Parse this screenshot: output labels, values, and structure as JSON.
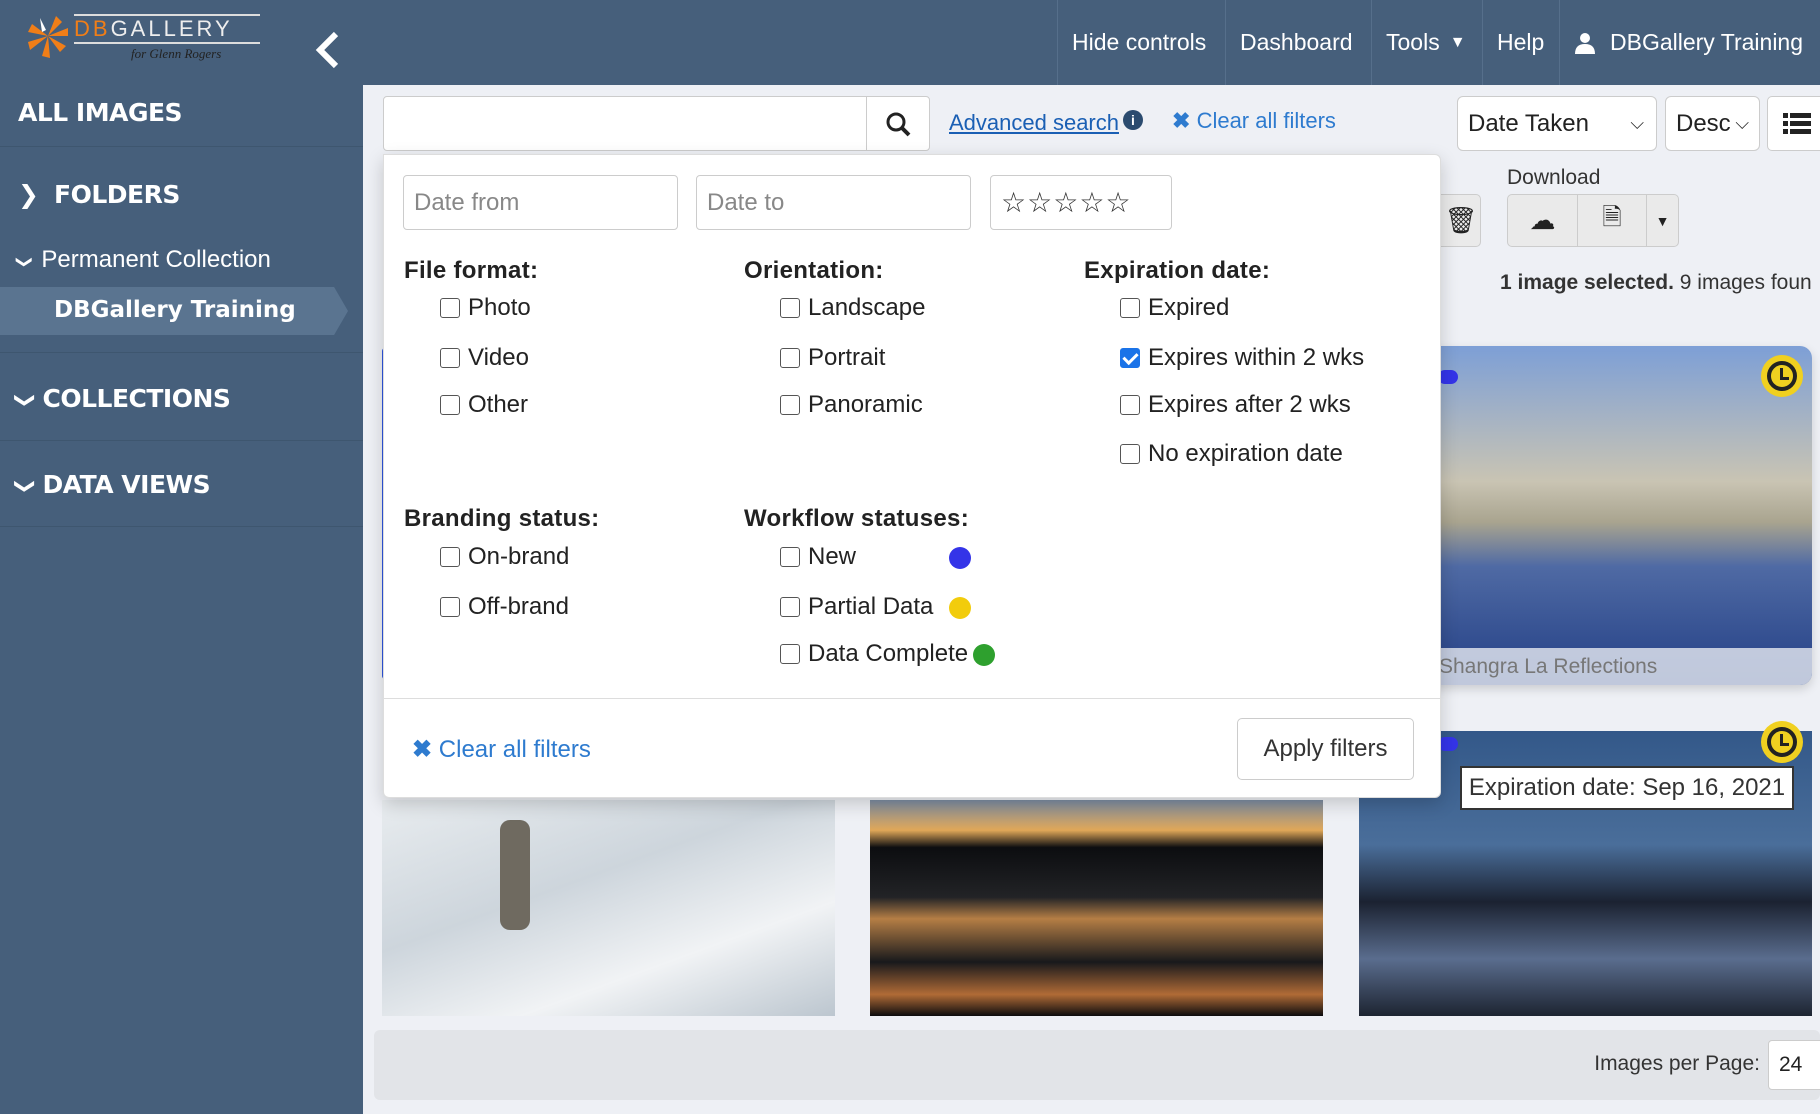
{
  "logo": {
    "text": "DBGALLERY",
    "tagline": "for Glenn Rogers"
  },
  "topnav": {
    "hide_controls": "Hide controls",
    "dashboard": "Dashboard",
    "tools": "Tools",
    "help": "Help",
    "user": "DBGallery Training"
  },
  "sidebar": {
    "all_images": "ALL IMAGES",
    "folders": "FOLDERS",
    "permanent_collection": "Permanent Collection",
    "selected_folder": "DBGallery Training",
    "collections": "COLLECTIONS",
    "data_views": "DATA VIEWS"
  },
  "search": {
    "value": "",
    "advanced": "Advanced search",
    "clear": "Clear all filters"
  },
  "sort": {
    "field": "Date Taken",
    "order": "Desc"
  },
  "filters": {
    "date_from": "Date from",
    "date_to": "Date to",
    "rating_stars": 5,
    "file_format": {
      "title": "File format:",
      "options": [
        {
          "label": "Photo",
          "checked": false
        },
        {
          "label": "Video",
          "checked": false
        },
        {
          "label": "Other",
          "checked": false
        }
      ]
    },
    "orientation": {
      "title": "Orientation:",
      "options": [
        {
          "label": "Landscape",
          "checked": false
        },
        {
          "label": "Portrait",
          "checked": false
        },
        {
          "label": "Panoramic",
          "checked": false
        }
      ]
    },
    "expiration": {
      "title": "Expiration date:",
      "options": [
        {
          "label": "Expired",
          "checked": false
        },
        {
          "label": "Expires within 2 wks",
          "checked": true
        },
        {
          "label": "Expires after 2 wks",
          "checked": false
        },
        {
          "label": "No expiration date",
          "checked": false
        }
      ]
    },
    "branding": {
      "title": "Branding status:",
      "options": [
        {
          "label": "On-brand",
          "checked": false
        },
        {
          "label": "Off-brand",
          "checked": false
        }
      ]
    },
    "workflow": {
      "title": "Workflow statuses:",
      "options": [
        {
          "label": "New",
          "checked": false,
          "color": "#3434e8"
        },
        {
          "label": "Partial Data",
          "checked": false,
          "color": "#f2cc0c"
        },
        {
          "label": "Data Complete",
          "checked": false,
          "color": "#2ea02e"
        }
      ]
    },
    "clear": "Clear all filters",
    "apply": "Apply filters"
  },
  "toolbar": {
    "download": "Download"
  },
  "selection": {
    "selected": "1 image selected.",
    "found": "9 images foun"
  },
  "cards": {
    "top_caption": "Shangra La Reflections",
    "tooltip": "Expiration date: Sep 16, 2021"
  },
  "footer": {
    "per_page_label": "Images per Page:",
    "per_page": "24"
  }
}
